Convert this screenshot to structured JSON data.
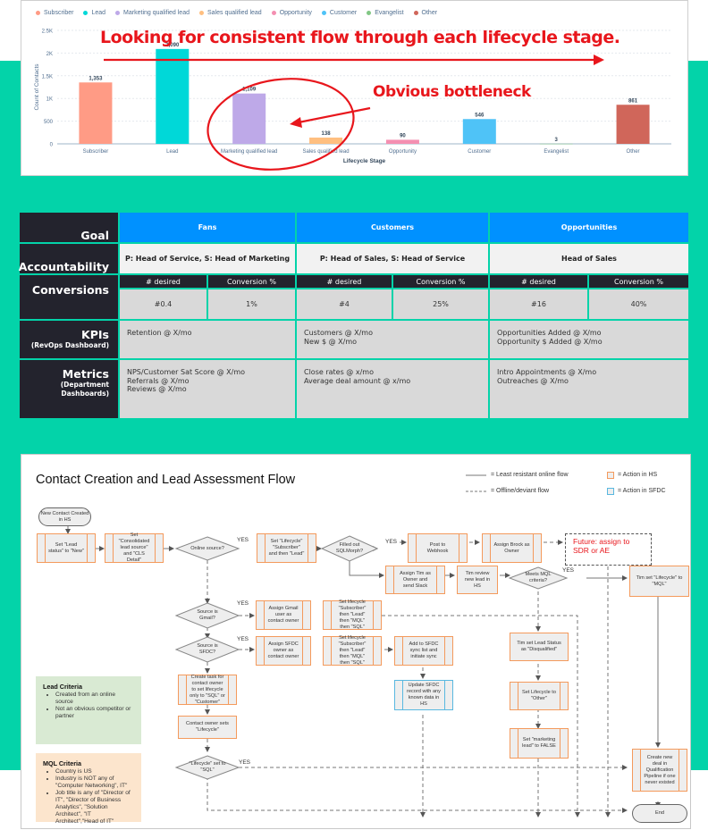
{
  "colors": {
    "background_band": "#03d3a9",
    "annotation_red": "#e8161c",
    "table_header_dark": "#23232d",
    "table_goal_blue": "#0091ff",
    "hs_action_border": "#f49a5c",
    "sfdc_action_border": "#59b8e0"
  },
  "chart_data": {
    "type": "bar",
    "title": "",
    "xlabel": "Lifecycle Stage",
    "ylabel": "Count of Contacts",
    "ylim": [
      0,
      2500
    ],
    "yticks": [
      0,
      500,
      1000,
      1500,
      2000,
      2500
    ],
    "ytick_labels": [
      "0",
      "500",
      "1K",
      "1.5K",
      "2K",
      "2.5K"
    ],
    "grid": true,
    "legend_position": "top-left",
    "categories": [
      "Subscriber",
      "Lead",
      "Marketing qualified lead",
      "Sales qualified lead",
      "Opportunity",
      "Customer",
      "Evangelist",
      "Other"
    ],
    "values": [
      1353,
      2090,
      1109,
      138,
      90,
      546,
      3,
      861
    ],
    "value_labels": [
      "1,353",
      "2,090",
      "1,109",
      "138",
      "90",
      "546",
      "3",
      "861"
    ],
    "colors": [
      "#ff9b85",
      "#00d8d8",
      "#bea9e8",
      "#ffbf80",
      "#f48fb1",
      "#4fc3f7",
      "#81c784",
      "#d0665a"
    ],
    "legend": [
      "Subscriber",
      "Lead",
      "Marketing qualified lead",
      "Sales qualified lead",
      "Opportunity",
      "Customer",
      "Evangelist",
      "Other"
    ],
    "annotations": [
      {
        "text": "Looking for consistent flow through each lifecycle stage.",
        "type": "arrow-right"
      },
      {
        "text": "Obvious bottleneck",
        "type": "circle-arrow",
        "target": [
          "Marketing qualified lead",
          "Sales qualified lead"
        ]
      }
    ]
  },
  "goal_table": {
    "row_headers": {
      "goal": "Goal",
      "accountability": "Accountability",
      "conversions": "Conversions",
      "kpis": "KPIs",
      "kpis_sub": "(RevOps Dashboard)",
      "metrics": "Metrics",
      "metrics_sub": "(Department Dashboards)"
    },
    "sub_headers": {
      "desired": "# desired",
      "conversion": "Conversion %"
    },
    "columns": [
      {
        "goal": "Fans",
        "accountability": "P: Head of Service, S: Head of Marketing",
        "desired": "#0.4",
        "conversion": "1%",
        "kpis": [
          "Retention @ X/mo"
        ],
        "metrics": [
          "NPS/Customer Sat Score @ X/mo",
          "Referrals @ X/mo",
          "Reviews @ X/mo"
        ]
      },
      {
        "goal": "Customers",
        "accountability": "P: Head of Sales, S: Head of Service",
        "desired": "#4",
        "conversion": "25%",
        "kpis": [
          "Customers @ X/mo",
          "New $ @ X/mo"
        ],
        "metrics": [
          "Close rates @ x/mo",
          "Average deal amount @ x/mo"
        ]
      },
      {
        "goal": "Opportunities",
        "accountability": "Head of Sales",
        "desired": "#16",
        "conversion": "40%",
        "kpis": [
          "Opportunities Added @ X/mo",
          "Opportunity $ Added @ X/mo"
        ],
        "metrics": [
          "Intro Appointments @ X/mo",
          "Outreaches @ X/mo"
        ]
      }
    ]
  },
  "flow": {
    "title": "Contact Creation and Lead Assessment Flow",
    "legend": {
      "solid": "= Least resistant online flow",
      "dashed": "= Offline/deviant flow",
      "hs": "= Action in HS",
      "sfdc": "= Action in SFDC"
    },
    "yes": "YES",
    "nodes": {
      "start": "New Contact Created in HS",
      "set_lead_status": "Set \"Lead status\" to \"New\"",
      "set_cls": "Set \"Consolidated lead source\" and \"CLS Detail\"",
      "online_source": "Online source?",
      "set_lifecycle_sub_lead": "Set \"Lifecycle\" \"Subscriber\" and then \"Lead\"",
      "filled_sqlmorph": "Filled out SQLMorph?",
      "post_webhook": "Post to Webhook",
      "assign_brock": "Assign Brock as Owner",
      "future": "Future: assign to SDR or AE",
      "assign_tim": "Assign Tim as Owner and send Slack",
      "tim_review": "Tim review new lead in HS",
      "meets_mql": "Meets MQL criteria?",
      "tim_set_mql": "Tim set \"Lifecycle\" to \"MQL\"",
      "source_gmail": "Source is Gmail?",
      "assign_gmail": "Assign Gmail user as contact owner",
      "set_lifecycle_gmail": "Set lifecycle \"Subscriber\" then \"Lead\" then \"MQL\" then \"SQL\"",
      "source_sfdc": "Source is SFDC?",
      "assign_sfdc": "Assign SFDC owner as contact owner",
      "set_lifecycle_sfdc": "Set lifecycle \"Subscriber\" then \"Lead\" then \"MQL\" then \"SQL\"",
      "add_sfdc_sync": "Add to SFDC sync list and initiate sync",
      "update_sfdc": "Update SFDC record with any known data in HS",
      "create_task": "Create task for contact owner to set lifecycle only to \"SQL\" or \"Customer\"",
      "contact_owner_sets": "Contact owner sets \"Lifecycle\"",
      "lifecycle_sql": "\"Lifecycle\" set to \"SQL\"",
      "tim_disqualified": "Tim set Lead Status as \"Disqualified\"",
      "set_other": "Set Lifecycle to \"Other\"",
      "set_marketing_false": "Set \"marketing lead\" to FALSE",
      "create_deal": "Create new deal in Qualification Pipeline if one never existed",
      "end": "End"
    },
    "lead_criteria": {
      "title": "Lead Criteria",
      "items": [
        "Created from an online source",
        "Not an obvious competitor or partner"
      ]
    },
    "mql_criteria": {
      "title": "MQL Criteria",
      "items": [
        "Country is US",
        "Industry is NOT any of \"Computer Networking\", IT\"",
        "Job title is any of \"Director of IT\", \"Director of Business Analytics\", \"Solution Architect\", \"IT Architect\",\"Head of IT\""
      ]
    }
  }
}
